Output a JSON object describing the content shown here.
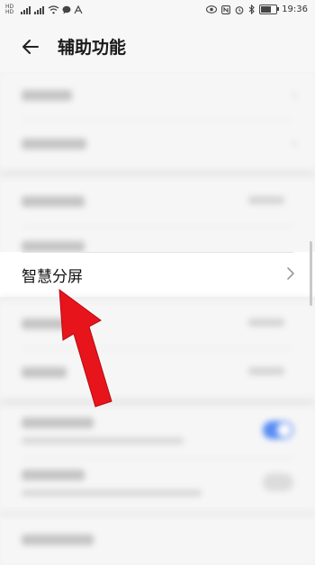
{
  "status_bar": {
    "time": "19:36",
    "left_icons": [
      "sim1-icon",
      "signal-icon",
      "sim2-icon",
      "signal-icon",
      "wifi-icon",
      "message-icon",
      "notification-icon"
    ],
    "right_icons": [
      "eye-comfort-icon",
      "nfc-icon",
      "alarm-icon",
      "bluetooth-icon",
      "battery-icon"
    ],
    "battery_level": 0.7
  },
  "header": {
    "title": "辅助功能"
  },
  "settings": {
    "blurred_rows_above": 5,
    "focused_item": {
      "label": "智慧分屏"
    },
    "blurred_rows_below": 5
  },
  "annotation": {
    "arrow_color": "#e8141b",
    "arrow_target": "智慧分屏"
  },
  "colors": {
    "background": "#f2f2f2",
    "card": "#f7f7f7",
    "accent": "#3d7bf5"
  }
}
